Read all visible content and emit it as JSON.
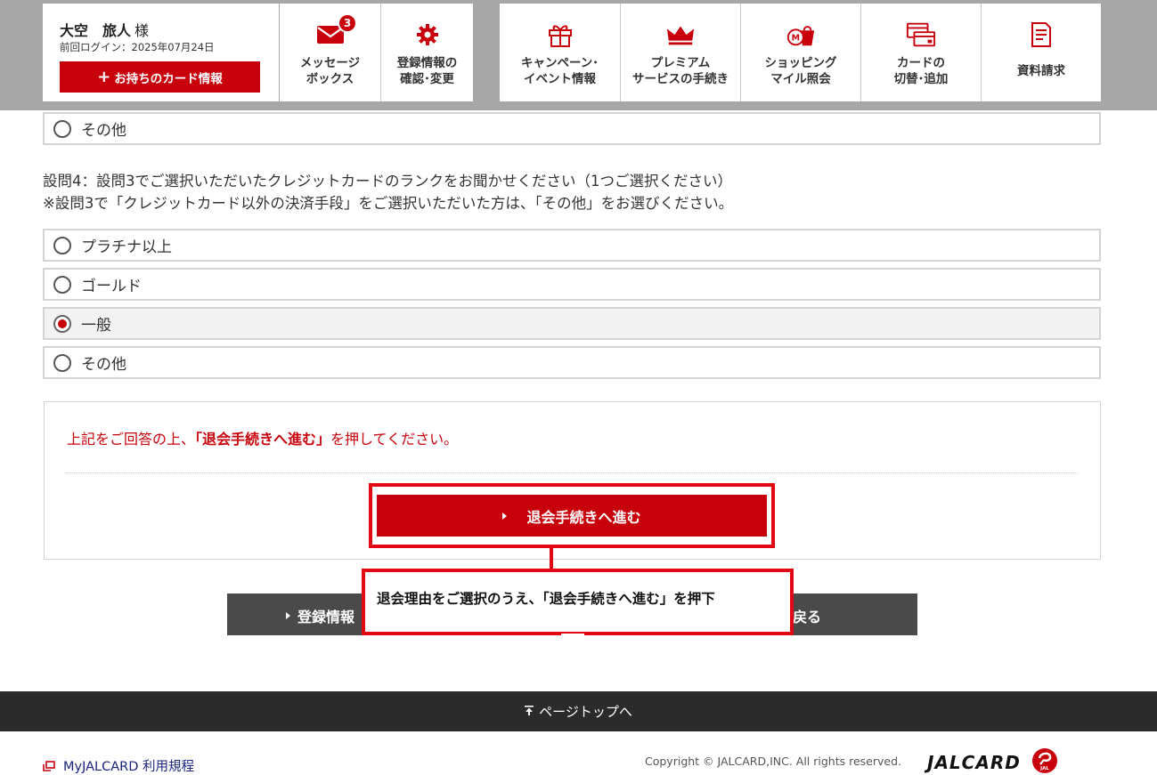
{
  "header": {
    "user_name": "大空　旅人",
    "honorific": "様",
    "last_login": "前回ログイン：2025年07月24日",
    "card_info_button": "お持ちのカード情報",
    "nav": [
      {
        "label": "メッセージ\nボックス",
        "icon": "envelope-icon",
        "badge": "3"
      },
      {
        "label": "登録情報の\n確認･変更",
        "icon": "gear-icon"
      },
      {
        "label": "キャンペーン･\nイベント情報",
        "icon": "gift-icon"
      },
      {
        "label": "プレミアム\nサービスの手続き",
        "icon": "crown-icon"
      },
      {
        "label": "ショッピング\nマイル照会",
        "icon": "shopping-bag-icon"
      },
      {
        "label": "カードの\n切替･追加",
        "icon": "cards-icon"
      },
      {
        "label": "資料請求",
        "icon": "document-icon"
      }
    ]
  },
  "q3_last_option": "その他",
  "question4": {
    "line1": "設問4：設問3でご選択いただいたクレジットカードのランクをお聞かせください（1つご選択ください）",
    "line2": "※設問3で「クレジットカード以外の決済手段」をご選択いただいた方は、「その他」をお選びください。",
    "options": [
      "プラチナ以上",
      "ゴールド",
      "一般",
      "その他"
    ],
    "selected": "一般"
  },
  "confirm": {
    "text_before": "上記をご回答の上、",
    "text_bold": "「退会手続きへ進む」",
    "text_after": "を押してください。",
    "proceed_button": "退会手続きへ進む"
  },
  "back_button": {
    "left_text": "登録情報",
    "right_text": "戻る"
  },
  "callout": "退会理由をご選択のうえ、「退会手続きへ進む」を押下",
  "footer": {
    "page_top": "ページトップへ",
    "terms_link": "MyJALCARD 利用規程",
    "copyright": "Copyright © JALCARD,INC. All rights reserved.",
    "logo_text": "JALCARD",
    "logo_mark_text": "JAL"
  },
  "colors": {
    "brand_red": "#c8000c",
    "highlight_red": "#e30613",
    "header_gray": "#a7a7a7",
    "dark_gray": "#4a4a4a",
    "footer_dark": "#2b2b2b"
  }
}
